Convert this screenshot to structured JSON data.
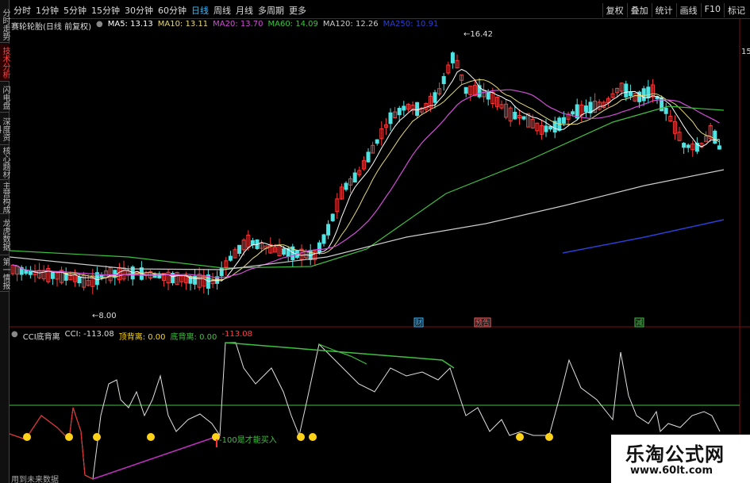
{
  "toolbar": {
    "periods": [
      {
        "label": "分时",
        "active": false
      },
      {
        "label": "1分钟",
        "active": false
      },
      {
        "label": "5分钟",
        "active": false
      },
      {
        "label": "15分钟",
        "active": false
      },
      {
        "label": "30分钟",
        "active": false
      },
      {
        "label": "60分钟",
        "active": false
      },
      {
        "label": "日线",
        "active": true
      },
      {
        "label": "周线",
        "active": false
      },
      {
        "label": "月线",
        "active": false
      },
      {
        "label": "多周期",
        "active": false
      },
      {
        "label": "更多",
        "active": false
      }
    ],
    "right_buttons": [
      "复权",
      "叠加",
      "统计",
      "画线",
      "F10",
      "标记"
    ]
  },
  "side_tabs": [
    {
      "label": "分时走势",
      "active": false
    },
    {
      "label": "技术分析",
      "active": true
    },
    {
      "label": "闪电盘",
      "active": false
    },
    {
      "label": "深度资料",
      "active": false
    },
    {
      "label": "核心题材",
      "active": false
    },
    {
      "label": "主营构成",
      "active": false
    },
    {
      "label": "龙虎数据",
      "active": false
    },
    {
      "label": "第一情报",
      "active": false
    }
  ],
  "main_chart": {
    "title": "赛轮轮胎(日线 前复权)",
    "ma": [
      {
        "label": "MA5: 13.13",
        "color": "#ffffff"
      },
      {
        "label": "MA10: 13.11",
        "color": "#e6d97a"
      },
      {
        "label": "MA20: 13.70",
        "color": "#d04fd6"
      },
      {
        "label": "MA60: 14.09",
        "color": "#40c040"
      },
      {
        "label": "MA120: 12.26",
        "color": "#cccccc"
      },
      {
        "label": "MA250: 10.91",
        "color": "#2b3fd6"
      }
    ],
    "high_label": "16.42",
    "low_label": "8.00",
    "right_axis_label": "15",
    "event_markers": [
      {
        "label": "财",
        "color": "#38b9ff"
      },
      {
        "label": "预告",
        "color": "#ff6060"
      },
      {
        "label": "减",
        "color": "#40c040"
      }
    ]
  },
  "cci_panel": {
    "name": "CCI底背离",
    "values": [
      {
        "label": "CCI: -113.08",
        "color": "#dddddd"
      },
      {
        "label": "顶背离: 0.00",
        "color": "#ffd700"
      },
      {
        "label": "底背离: 0.00",
        "color": "#40c040"
      },
      {
        "label": "-113.08",
        "color": "#ff4040"
      }
    ],
    "annotation": "-100是才能买入",
    "footer": "用到未来数据"
  },
  "watermark": {
    "title": "乐淘公式网",
    "url": "www.60lt.com"
  }
}
